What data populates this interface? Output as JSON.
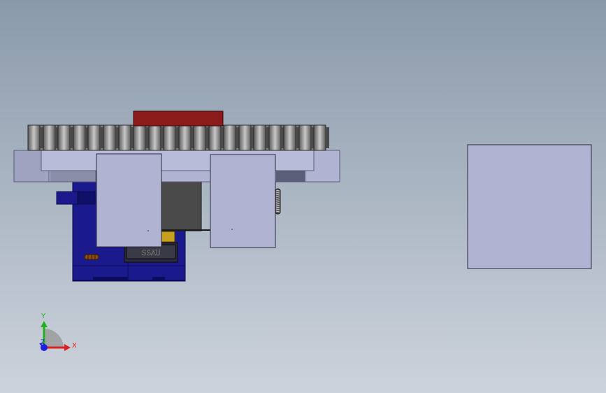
{
  "viewport": {
    "background_top": "#8a9aab",
    "background_bottom": "#cdd3dc"
  },
  "model": {
    "part_colors": {
      "red_block": "#8b1a1a",
      "gear_dark": "#6a6a6a",
      "gear_light": "#bdbdbd",
      "plate_lavender": "#b0b4d2",
      "plate_shadow": "#8a8ea8",
      "housing_blue": "#1a1a8c",
      "housing_blue_dark": "#0c0c5e",
      "motor_gray": "#4a4a4a",
      "brass": "#c8a020",
      "outline": "#1a1a2a"
    },
    "housing_label": "SSAU"
  },
  "triad": {
    "x_label": "X",
    "y_label": "Y",
    "z_label": "Z",
    "x_color": "#e02020",
    "y_color": "#20b020",
    "z_color": "#2020e0"
  }
}
